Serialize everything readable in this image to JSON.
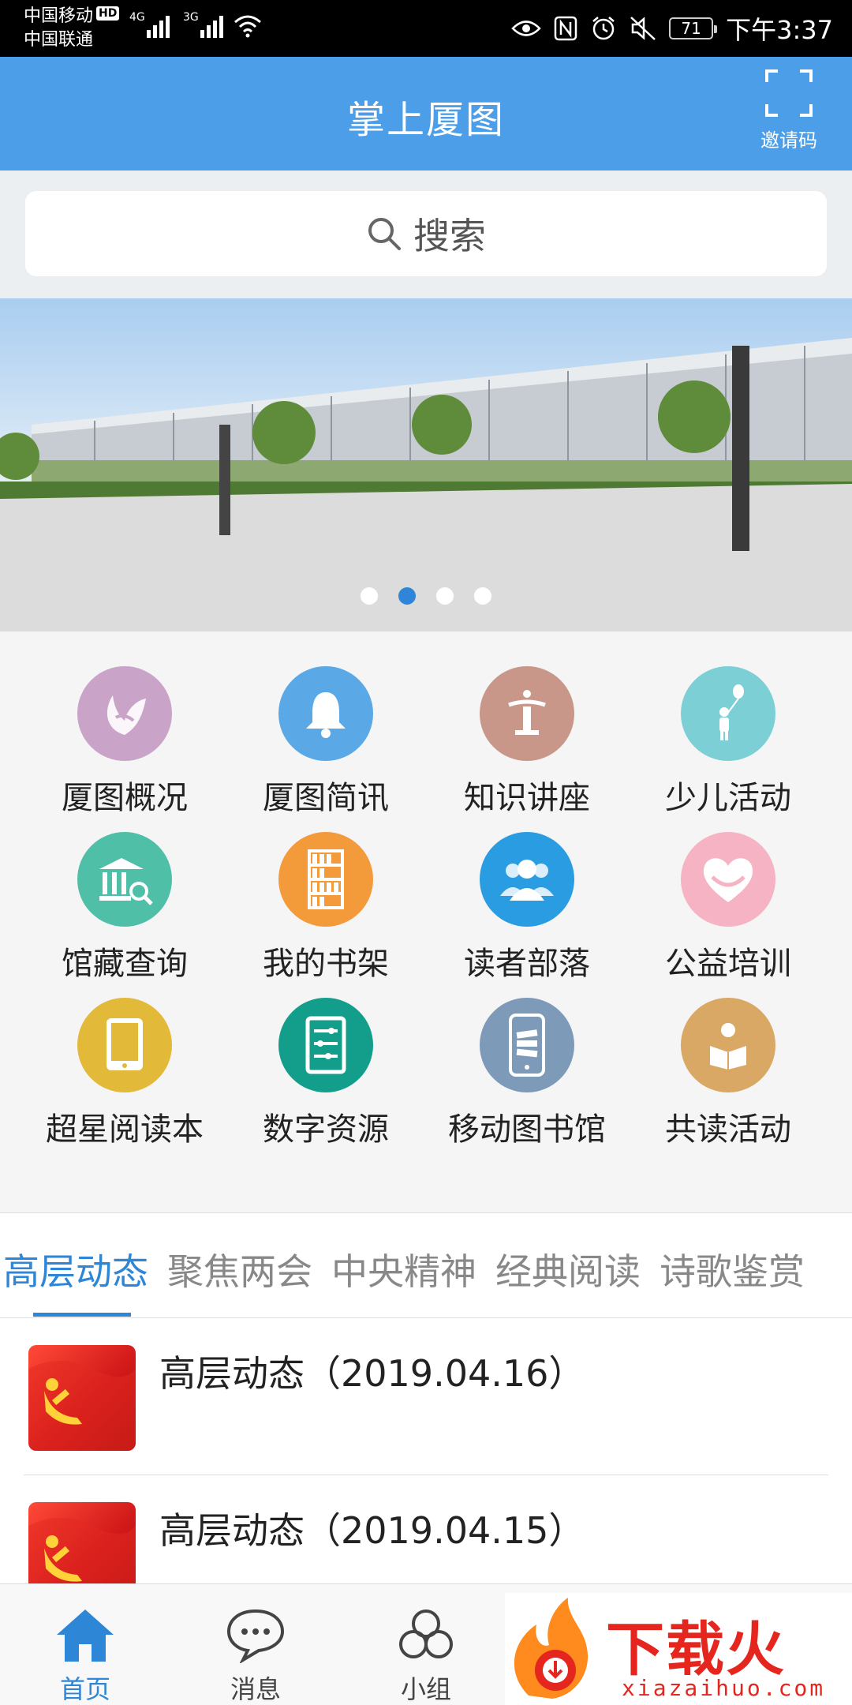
{
  "status_bar": {
    "carrier1": "中国移动",
    "carrier1_badge": "HD",
    "carrier2": "中国联通",
    "net1": "4G",
    "net2": "3G",
    "battery": "71",
    "time": "下午3:37"
  },
  "header": {
    "title": "掌上厦图",
    "invite_label": "邀请码"
  },
  "search": {
    "placeholder": "搜索"
  },
  "banner": {
    "slide_count": 4,
    "active_slide": 2
  },
  "grid": {
    "items": [
      {
        "label": "厦图概况",
        "color": "#c9a3c8",
        "icon": "butterfly-icon"
      },
      {
        "label": "厦图简讯",
        "color": "#5aa9e6",
        "icon": "bell-icon"
      },
      {
        "label": "知识讲座",
        "color": "#c9978a",
        "icon": "lectern-icon"
      },
      {
        "label": "少儿活动",
        "color": "#7dcfd6",
        "icon": "child-balloon-icon"
      },
      {
        "label": "馆藏查询",
        "color": "#4fbfa8",
        "icon": "library-search-icon"
      },
      {
        "label": "我的书架",
        "color": "#f39a3b",
        "icon": "bookshelf-icon"
      },
      {
        "label": "读者部落",
        "color": "#2a9de2",
        "icon": "readers-group-icon"
      },
      {
        "label": "公益培训",
        "color": "#f5b3c3",
        "icon": "heart-hands-icon"
      },
      {
        "label": "超星阅读本",
        "color": "#e3b93a",
        "icon": "tablet-icon"
      },
      {
        "label": "数字资源",
        "color": "#139e8b",
        "icon": "digital-resource-icon"
      },
      {
        "label": "移动图书馆",
        "color": "#7d9bb8",
        "icon": "mobile-library-icon"
      },
      {
        "label": "共读活动",
        "color": "#d9a865",
        "icon": "reading-person-icon"
      }
    ]
  },
  "tabs": {
    "items": [
      "高层动态",
      "聚焦两会",
      "中央精神",
      "经典阅读",
      "诗歌鉴赏"
    ],
    "active": 0
  },
  "news": {
    "items": [
      {
        "title": "高层动态（2019.04.16）"
      },
      {
        "title": "高层动态（2019.04.15）"
      }
    ]
  },
  "bottom_nav": {
    "items": [
      {
        "label": "首页",
        "icon": "home-icon"
      },
      {
        "label": "消息",
        "icon": "chat-bubble-icon"
      },
      {
        "label": "小组",
        "icon": "group-icon"
      }
    ],
    "active": 0
  },
  "watermark": {
    "brand": "下载火",
    "domain": "xiazaihuo.com"
  },
  "colors": {
    "header_bg": "#4c9ee8",
    "accent": "#2e86d6",
    "watermark_red": "#e5261e"
  }
}
